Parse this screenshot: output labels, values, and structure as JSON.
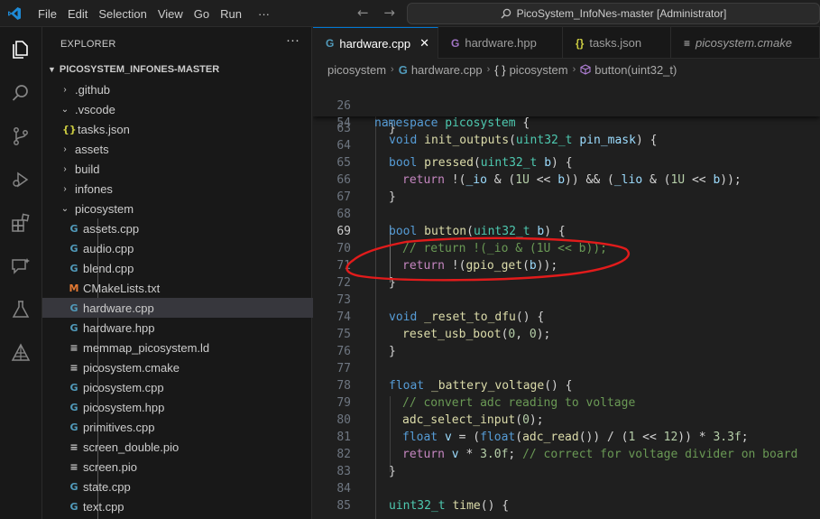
{
  "menu": [
    "File",
    "Edit",
    "Selection",
    "View",
    "Go",
    "Run",
    "···"
  ],
  "nav": {
    "back": "←",
    "forward": "→"
  },
  "search": {
    "text": "PicoSystem_InfoNes-master [Administrator]"
  },
  "sidebar": {
    "title": "EXPLORER",
    "more": "···",
    "root": "PICOSYSTEM_INFONES-MASTER",
    "items": [
      {
        "label": ".github",
        "chev": "›",
        "icon": ""
      },
      {
        "label": ".vscode",
        "chev": "⌄",
        "icon": ""
      },
      {
        "label": "tasks.json",
        "chev": "",
        "icon": "{}"
      },
      {
        "label": "assets",
        "chev": "›",
        "icon": ""
      },
      {
        "label": "build",
        "chev": "›",
        "icon": ""
      },
      {
        "label": "infones",
        "chev": "›",
        "icon": ""
      },
      {
        "label": "picosystem",
        "chev": "⌄",
        "icon": ""
      },
      {
        "label": "assets.cpp",
        "chev": "",
        "icon": "G"
      },
      {
        "label": "audio.cpp",
        "chev": "",
        "icon": "G"
      },
      {
        "label": "blend.cpp",
        "chev": "",
        "icon": "G"
      },
      {
        "label": "CMakeLists.txt",
        "chev": "",
        "icon": "M"
      },
      {
        "label": "hardware.cpp",
        "chev": "",
        "icon": "G"
      },
      {
        "label": "hardware.hpp",
        "chev": "",
        "icon": "G"
      },
      {
        "label": "memmap_picosystem.ld",
        "chev": "",
        "icon": "≡"
      },
      {
        "label": "picosystem.cmake",
        "chev": "",
        "icon": "≡"
      },
      {
        "label": "picosystem.cpp",
        "chev": "",
        "icon": "G"
      },
      {
        "label": "picosystem.hpp",
        "chev": "",
        "icon": "G"
      },
      {
        "label": "primitives.cpp",
        "chev": "",
        "icon": "G"
      },
      {
        "label": "screen_double.pio",
        "chev": "",
        "icon": "≡"
      },
      {
        "label": "screen.pio",
        "chev": "",
        "icon": "≡"
      },
      {
        "label": "state.cpp",
        "chev": "",
        "icon": "G"
      },
      {
        "label": "text.cpp",
        "chev": "",
        "icon": "G"
      }
    ]
  },
  "tabs": [
    {
      "label": "hardware.cpp",
      "icon": "G",
      "close": "✕"
    },
    {
      "label": "hardware.hpp",
      "icon": "G"
    },
    {
      "label": "tasks.json",
      "icon": "{}"
    },
    {
      "label": "picosystem.cmake",
      "icon": "≡"
    }
  ],
  "breadcrumb": [
    "picosystem",
    "hardware.cpp",
    "picosystem",
    "button(uint32_t)"
  ],
  "editor": {
    "sticky_numbers": [
      "26",
      "54"
    ],
    "line_numbers": [
      "63",
      "64",
      "65",
      "66",
      "67",
      "68",
      "69",
      "70",
      "71",
      "72",
      "73",
      "74",
      "75",
      "76",
      "77",
      "78",
      "79",
      "80",
      "81",
      "82",
      "83",
      "84",
      "85"
    ],
    "current_line": "69"
  },
  "colors": {
    "accent": "#0078d4",
    "annotation": "#e21b1b"
  }
}
